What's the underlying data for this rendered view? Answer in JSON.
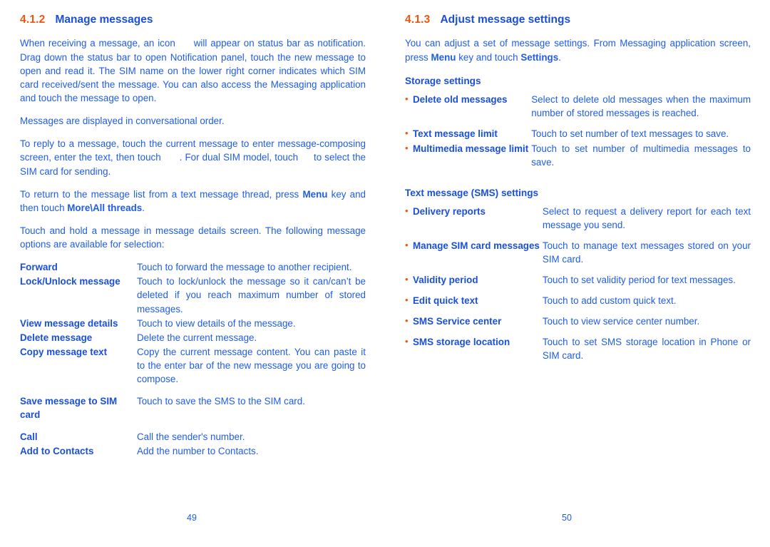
{
  "left_page": {
    "heading": {
      "number": "4.1.2",
      "title": "Manage messages"
    },
    "paragraphs": {
      "p1_a": "When receiving a message, an icon",
      "p1_b": "will appear on status bar as notification. Drag down the status bar to open Notification panel, touch the new message to open and read it. The SIM name on the lower right corner indicates which SIM card received/sent the message. You can also access the Messaging application and touch the message to open.",
      "p2": "Messages are displayed in conversational order.",
      "p3_a": "To reply to a message, touch the current message to enter message-composing screen, enter the text, then touch",
      "p3_b": ". For dual SIM model, touch",
      "p3_c": "to select the SIM card for sending.",
      "p4_a": "To return to the message list from a text message thread, press",
      "p4_menu": "Menu",
      "p4_b": "key and then touch",
      "p4_more": "More\\All threads",
      "p4_c": ".",
      "p5": "Touch and hold a message in message details screen. The following message options are available for selection:"
    },
    "options": [
      {
        "term": "Forward",
        "desc": "Touch to forward the message to another recipient."
      },
      {
        "term": "Lock/Unlock message",
        "desc": "Touch to lock/unlock the message so it can/can’t be deleted if you reach maximum number of stored messages."
      },
      {
        "term": "View message details",
        "desc": "Touch to view details of the message."
      },
      {
        "term": "Delete message",
        "desc": "Delete the current message."
      },
      {
        "term": "Copy message text",
        "desc": "Copy the current message content. You can paste it to the enter bar of the new message you are going to compose."
      },
      {
        "term": "Save message to SIM card",
        "desc": "Touch to save the SMS to the SIM card."
      },
      {
        "term": "Call",
        "desc": "Call the sender's number."
      },
      {
        "term": "Add to Contacts",
        "desc": "Add the number to Contacts."
      }
    ],
    "folio": "49"
  },
  "right_page": {
    "heading": {
      "number": "4.1.3",
      "title": "Adjust message settings"
    },
    "paragraphs": {
      "p1_a": "You can adjust a set of message settings. From Messaging application screen, press",
      "p1_menu": "Menu",
      "p1_b": "key and touch",
      "p1_settings": "Settings",
      "p1_c": "."
    },
    "storage_settings": {
      "heading": "Storage settings",
      "items": [
        {
          "bullet": "•",
          "term": "Delete old messages",
          "desc": "Select to delete old messages when the maximum number of stored messages is reached."
        },
        {
          "bullet": "•",
          "term": "Text message limit",
          "desc": "Touch to set number of text messages to save."
        },
        {
          "bullet": "•",
          "term": "Multimedia message limit",
          "desc": "Touch to set number of multimedia messages to save."
        }
      ]
    },
    "sms_settings": {
      "heading": "Text message (SMS) settings",
      "items": [
        {
          "bullet": "•",
          "term": "Delivery reports",
          "desc": "Select to request a delivery report for each text message you send."
        },
        {
          "bullet": "•",
          "term": "Manage SIM card messages",
          "desc": "Touch to manage text messages stored on your SIM card."
        },
        {
          "bullet": "•",
          "term": "Validity period",
          "desc": "Touch to set validity period for text messages."
        },
        {
          "bullet": "•",
          "term": "Edit quick text",
          "desc": "Touch to add custom quick text."
        },
        {
          "bullet": "•",
          "term": "SMS Service center",
          "desc": "Touch to view service center number."
        },
        {
          "bullet": "•",
          "term": "SMS storage location",
          "desc": "Touch to set SMS storage location in Phone or SIM card."
        }
      ]
    },
    "folio": "50"
  },
  "colors": {
    "heading_number": "#f0550f",
    "heading_title": "#1a4fd8",
    "body_text": "#1f5ce8",
    "bullet": "#f0550f",
    "background": "#ffffff"
  }
}
